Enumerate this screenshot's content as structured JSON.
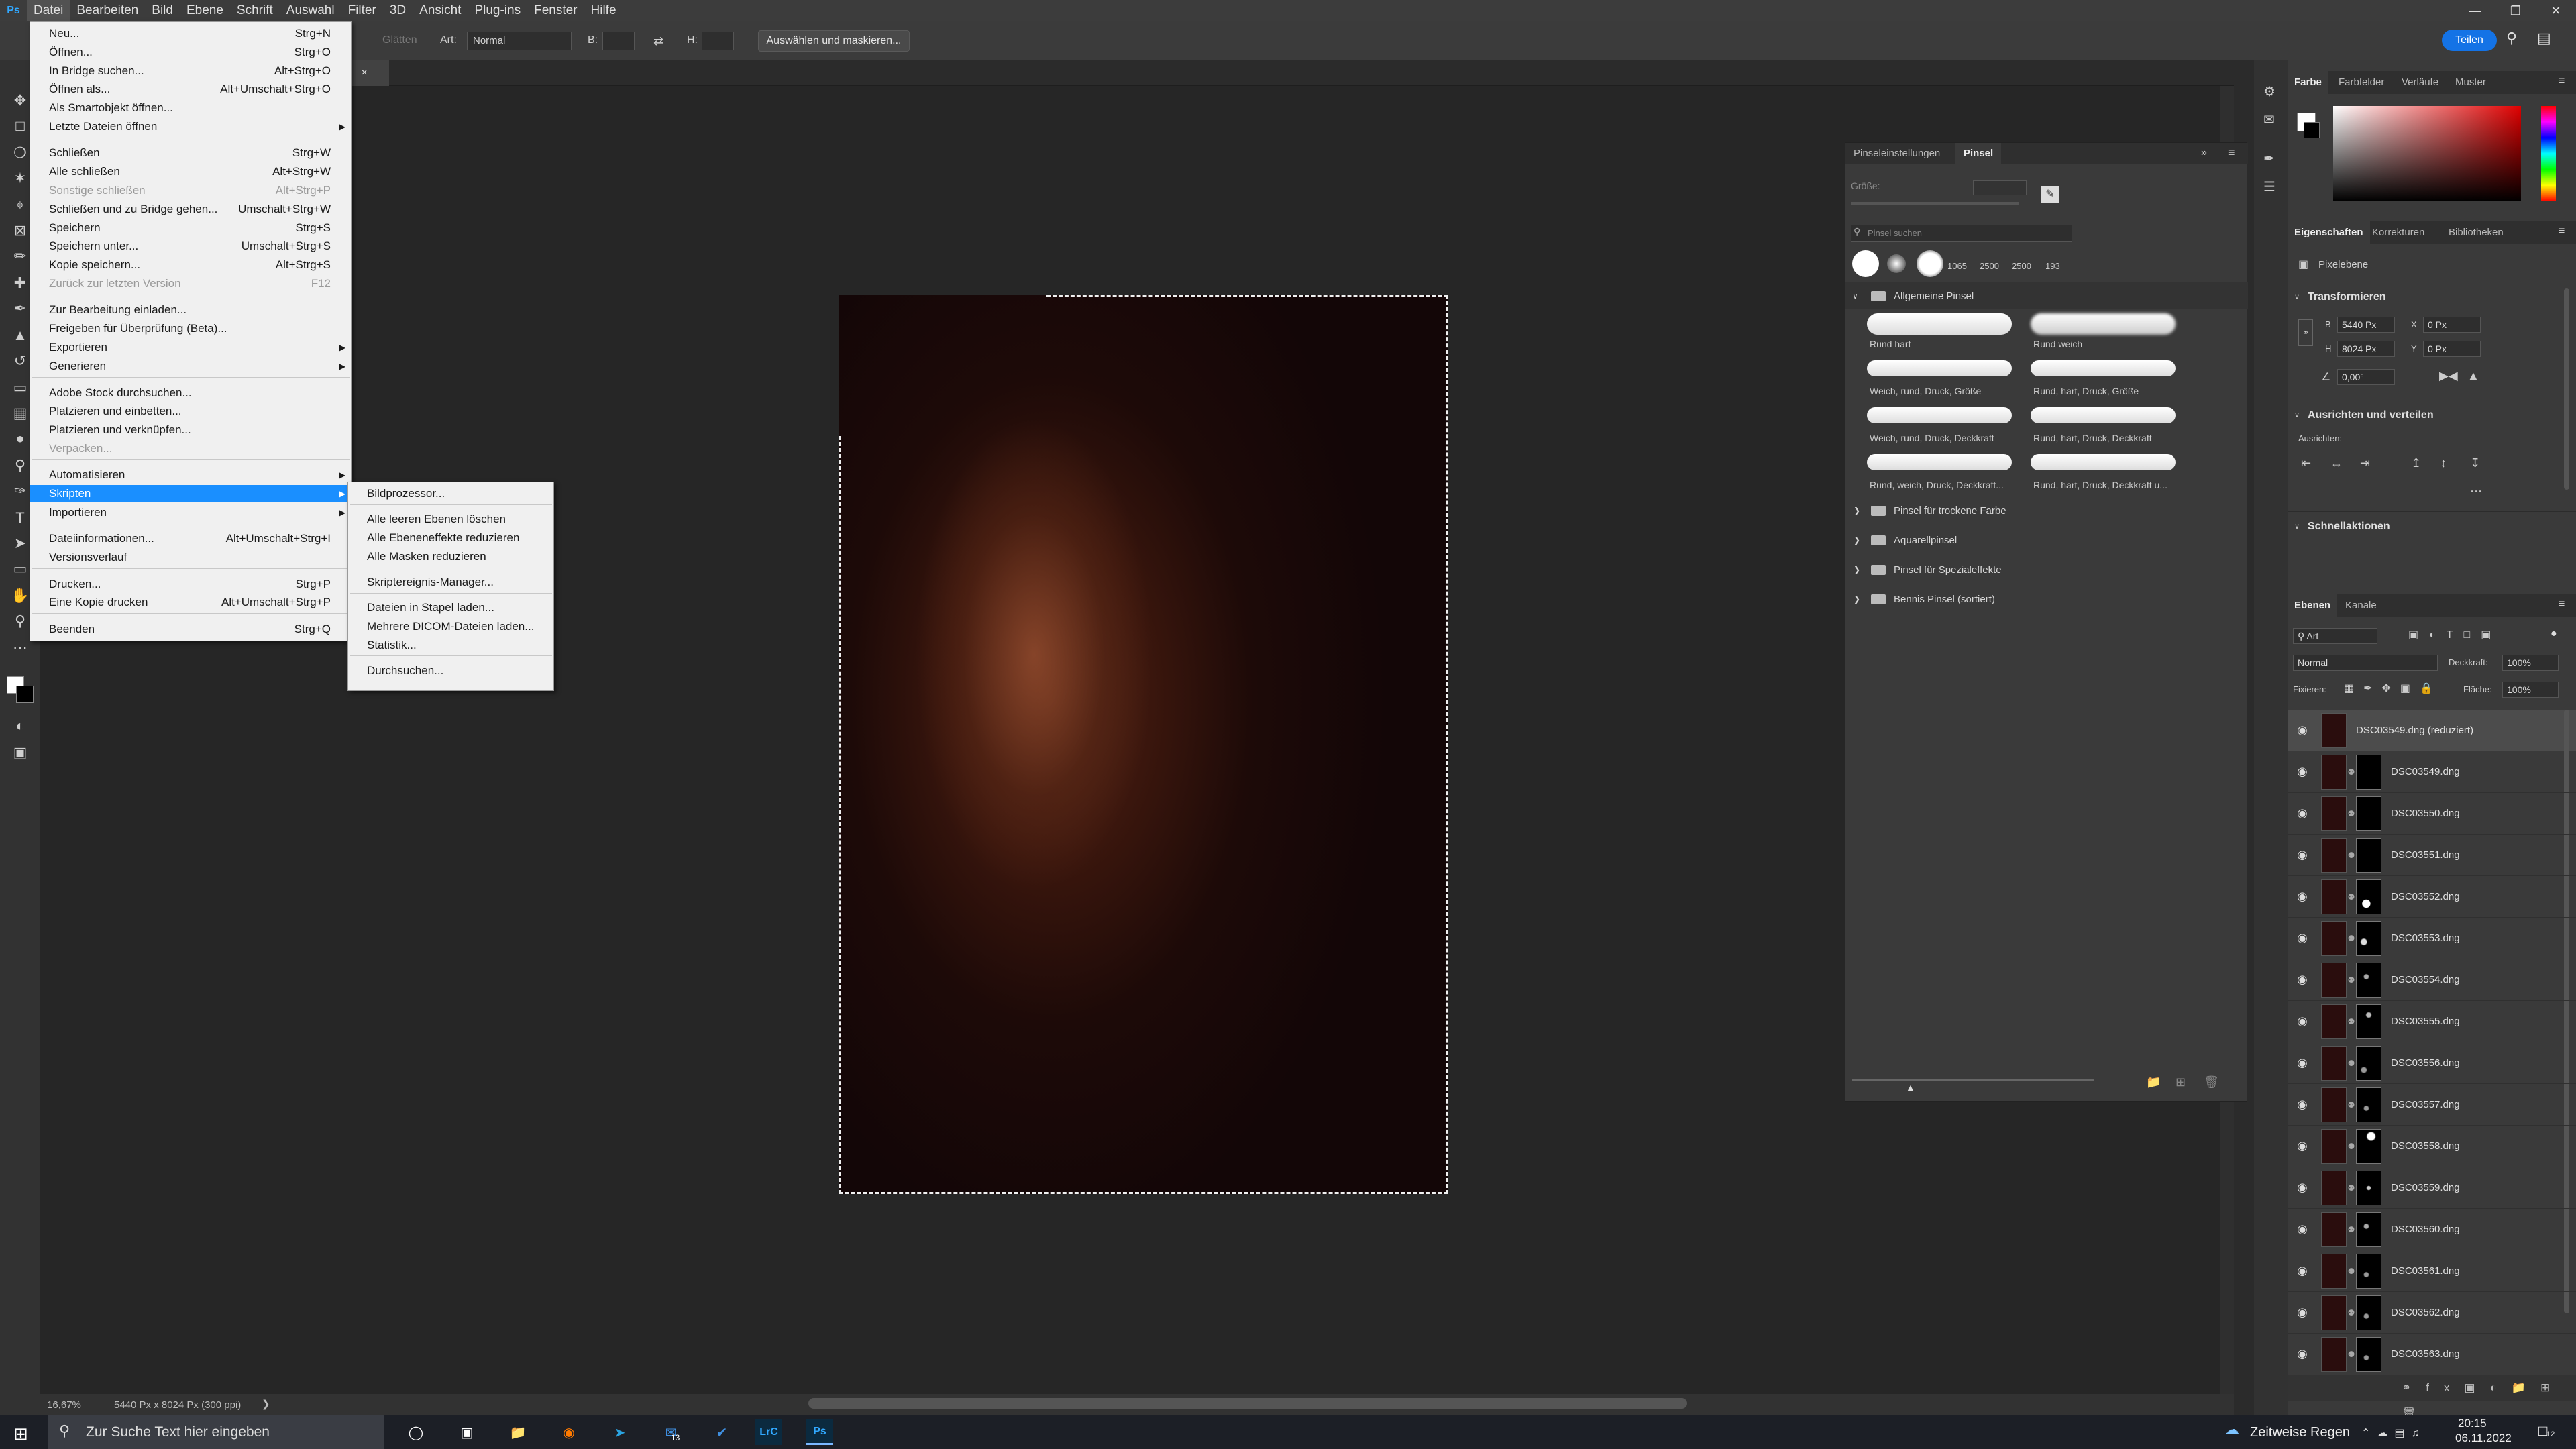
{
  "menubar": {
    "logo": "Ps",
    "items": [
      "Datei",
      "Bearbeiten",
      "Bild",
      "Ebene",
      "Schrift",
      "Auswahl",
      "Filter",
      "3D",
      "Ansicht",
      "Plug-ins",
      "Fenster",
      "Hilfe"
    ],
    "active": "Datei"
  },
  "options": {
    "glaetten": "Glätten",
    "art_label": "Art:",
    "art_value": "Normal",
    "b_label": "B:",
    "h_label": "H:",
    "select_mask": "Auswählen und maskieren...",
    "share": "Teilen"
  },
  "document_tab": {
    "suffix": ") *",
    "close": "×"
  },
  "file_menu": {
    "items": [
      {
        "label": "Neu...",
        "shortcut": "Strg+N"
      },
      {
        "label": "Öffnen...",
        "shortcut": "Strg+O"
      },
      {
        "label": "In Bridge suchen...",
        "shortcut": "Alt+Strg+O"
      },
      {
        "label": "Öffnen als...",
        "shortcut": "Alt+Umschalt+Strg+O"
      },
      {
        "label": "Als Smartobjekt öffnen...",
        "shortcut": ""
      },
      {
        "label": "Letzte Dateien öffnen",
        "shortcut": "",
        "submenu": true
      },
      {
        "label": "Schließen",
        "shortcut": "Strg+W"
      },
      {
        "label": "Alle schließen",
        "shortcut": "Alt+Strg+W"
      },
      {
        "label": "Sonstige schließen",
        "shortcut": "Alt+Strg+P",
        "disabled": true
      },
      {
        "label": "Schließen und zu Bridge gehen...",
        "shortcut": "Umschalt+Strg+W"
      },
      {
        "label": "Speichern",
        "shortcut": "Strg+S"
      },
      {
        "label": "Speichern unter...",
        "shortcut": "Umschalt+Strg+S"
      },
      {
        "label": "Kopie speichern...",
        "shortcut": "Alt+Strg+S"
      },
      {
        "label": "Zurück zur letzten Version",
        "shortcut": "F12",
        "disabled": true
      },
      {
        "label": "Zur Bearbeitung einladen...",
        "shortcut": ""
      },
      {
        "label": "Freigeben für Überprüfung (Beta)...",
        "shortcut": ""
      },
      {
        "label": "Exportieren",
        "shortcut": "",
        "submenu": true
      },
      {
        "label": "Generieren",
        "shortcut": "",
        "submenu": true
      },
      {
        "label": "Adobe Stock durchsuchen...",
        "shortcut": ""
      },
      {
        "label": "Platzieren und einbetten...",
        "shortcut": ""
      },
      {
        "label": "Platzieren und verknüpfen...",
        "shortcut": ""
      },
      {
        "label": "Verpacken...",
        "shortcut": "",
        "disabled": true
      },
      {
        "label": "Automatisieren",
        "shortcut": "",
        "submenu": true
      },
      {
        "label": "Skripten",
        "shortcut": "",
        "submenu": true,
        "highlight": true
      },
      {
        "label": "Importieren",
        "shortcut": "",
        "submenu": true
      },
      {
        "label": "Dateiinformationen...",
        "shortcut": "Alt+Umschalt+Strg+I"
      },
      {
        "label": "Versionsverlauf",
        "shortcut": ""
      },
      {
        "label": "Drucken...",
        "shortcut": "Strg+P"
      },
      {
        "label": "Eine Kopie drucken",
        "shortcut": "Alt+Umschalt+Strg+P"
      },
      {
        "label": "Beenden",
        "shortcut": "Strg+Q"
      }
    ]
  },
  "skript_menu": {
    "items": [
      "Bildprozessor...",
      "Alle leeren Ebenen löschen",
      "Alle Ebeneneffekte reduzieren",
      "Alle Masken reduzieren",
      "Skriptereignis-Manager...",
      "Dateien in Stapel laden...",
      "Mehrere DICOM-Dateien laden...",
      "Statistik...",
      "Durchsuchen..."
    ]
  },
  "brush_panel": {
    "tabs": [
      "Pinseleinstellungen",
      "Pinsel"
    ],
    "active_tab": "Pinsel",
    "size_label": "Größe:",
    "search_placeholder": "Pinsel suchen",
    "recent_sizes": [
      "1065",
      "2500",
      "2500",
      "193"
    ],
    "group_open": "Allgemeine Pinsel",
    "brushes": [
      "Rund hart",
      "Rund weich",
      "Weich, rund, Druck, Größe",
      "Rund, hart, Druck, Größe",
      "Weich, rund, Druck, Deckkraft",
      "Rund, hart, Druck, Deckkraft",
      "Rund, weich, Druck, Deckkraft...",
      "Rund, hart, Druck, Deckkraft u..."
    ],
    "folders": [
      "Pinsel für trockene Farbe",
      "Aquarellpinsel",
      "Pinsel für Spezialeffekte",
      "Bennis Pinsel (sortiert)"
    ]
  },
  "color_panel": {
    "tabs": [
      "Farbe",
      "Farbfelder",
      "Verläufe",
      "Muster"
    ],
    "active": "Farbe"
  },
  "properties_panel": {
    "tabs": [
      "Eigenschaften",
      "Korrekturen",
      "Bibliotheken"
    ],
    "active": "Eigenschaften",
    "layer_type": "Pixelebene",
    "transform_title": "Transformieren",
    "w_label": "B",
    "w_value": "5440 Px",
    "h_label": "H",
    "h_value": "8024 Px",
    "x_label": "X",
    "x_value": "0 Px",
    "y_label": "Y",
    "y_value": "0 Px",
    "angle": "0,00°",
    "align_title": "Ausrichten und verteilen",
    "align_label": "Ausrichten:",
    "quick_title": "Schnellaktionen"
  },
  "layers_panel": {
    "tabs": [
      "Ebenen",
      "Kanäle"
    ],
    "active": "Ebenen",
    "filter_kind": "Art",
    "blend_mode": "Normal",
    "opacity_label": "Deckkraft:",
    "opacity_value": "100%",
    "lock_label": "Fixieren:",
    "fill_label": "Fläche:",
    "fill_value": "100%",
    "layers": [
      "DSC03549.dng (reduziert)",
      "DSC03549.dng",
      "DSC03550.dng",
      "DSC03551.dng",
      "DSC03552.dng",
      "DSC03553.dng",
      "DSC03554.dng",
      "DSC03555.dng",
      "DSC03556.dng",
      "DSC03557.dng",
      "DSC03558.dng",
      "DSC03559.dng",
      "DSC03560.dng",
      "DSC03561.dng",
      "DSC03562.dng",
      "DSC03563.dng"
    ]
  },
  "status": {
    "zoom": "16,67%",
    "doc_info": "5440 Px x 8024 Px (300 ppi)"
  },
  "taskbar": {
    "search_placeholder": "Zur Suche Text hier eingeben",
    "weather": "Zeitweise Regen",
    "time": "20:15",
    "date": "06.11.2022",
    "mail_badge": "13",
    "notif_badge": "12",
    "lrc": "LrC",
    "ps": "Ps"
  }
}
